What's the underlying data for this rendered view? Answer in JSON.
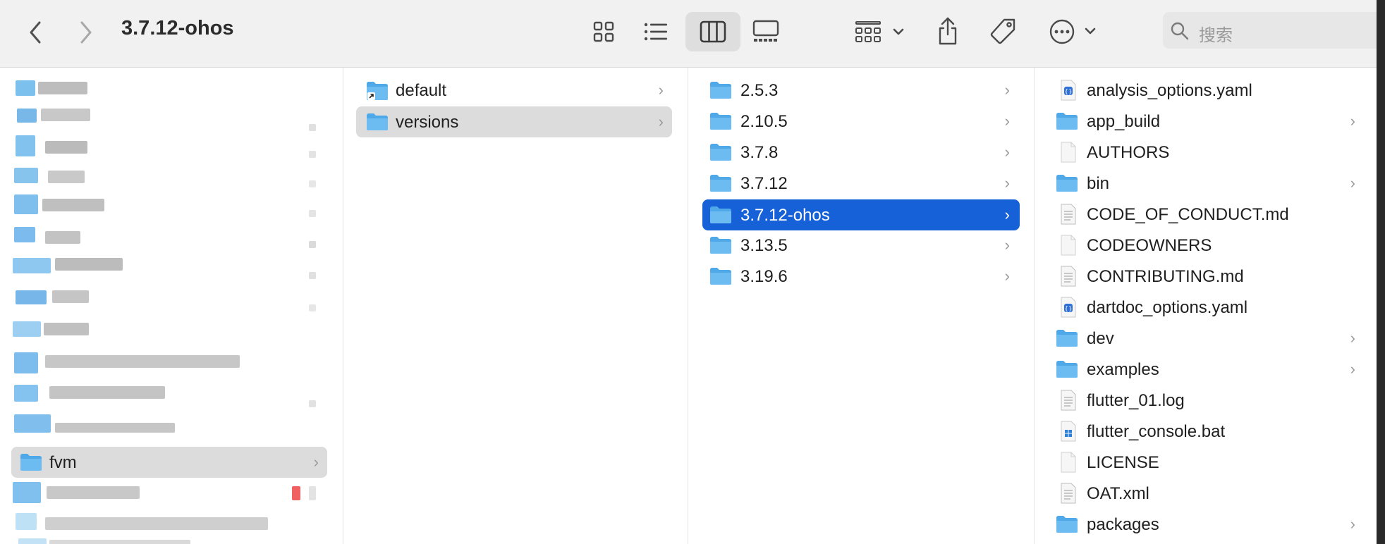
{
  "window": {
    "title": "3.7.12-ohos",
    "search_placeholder": "搜索"
  },
  "toolbar": {
    "icons": [
      "back-icon",
      "forward-icon",
      "icon-view-icon",
      "list-view-icon",
      "column-view-icon",
      "gallery-view-icon",
      "group-by-icon",
      "share-icon",
      "tag-icon",
      "more-icon",
      "search-icon"
    ]
  },
  "sidebar": {
    "visible_items": [
      {
        "label": "fvm",
        "selected": true
      }
    ]
  },
  "column1": {
    "items": [
      {
        "label": "default",
        "type": "alias-folder",
        "has_children": true
      },
      {
        "label": "versions",
        "type": "folder",
        "has_children": true,
        "selected": true
      }
    ]
  },
  "column2": {
    "items": [
      {
        "label": "2.5.3",
        "type": "folder"
      },
      {
        "label": "2.10.5",
        "type": "folder"
      },
      {
        "label": "3.7.8",
        "type": "folder"
      },
      {
        "label": "3.7.12",
        "type": "folder"
      },
      {
        "label": "3.7.12-ohos",
        "type": "folder",
        "selected": true
      },
      {
        "label": "3.13.5",
        "type": "folder"
      },
      {
        "label": "3.19.6",
        "type": "folder"
      }
    ]
  },
  "column3": {
    "items": [
      {
        "label": "analysis_options.yaml",
        "type": "yaml"
      },
      {
        "label": "app_build",
        "type": "folder"
      },
      {
        "label": "AUTHORS",
        "type": "file"
      },
      {
        "label": "bin",
        "type": "folder"
      },
      {
        "label": "CODE_OF_CONDUCT.md",
        "type": "text"
      },
      {
        "label": "CODEOWNERS",
        "type": "file"
      },
      {
        "label": "CONTRIBUTING.md",
        "type": "text"
      },
      {
        "label": "dartdoc_options.yaml",
        "type": "yaml"
      },
      {
        "label": "dev",
        "type": "folder"
      },
      {
        "label": "examples",
        "type": "folder"
      },
      {
        "label": "flutter_01.log",
        "type": "text"
      },
      {
        "label": "flutter_console.bat",
        "type": "bat"
      },
      {
        "label": "LICENSE",
        "type": "file"
      },
      {
        "label": "OAT.xml",
        "type": "text"
      },
      {
        "label": "packages",
        "type": "folder"
      }
    ]
  },
  "colors": {
    "accent": "#1761d8",
    "folder": "#5eb3ee",
    "selection_gray": "#dcdcdc"
  }
}
